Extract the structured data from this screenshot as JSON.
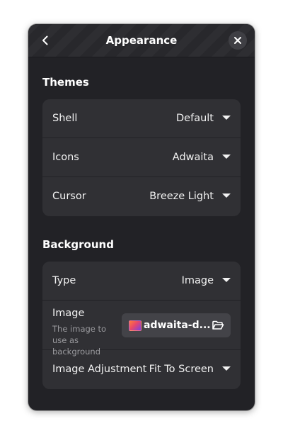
{
  "header": {
    "title": "Appearance"
  },
  "themes": {
    "section_title": "Themes",
    "rows": [
      {
        "label": "Shell",
        "value": "Default"
      },
      {
        "label": "Icons",
        "value": "Adwaita"
      },
      {
        "label": "Cursor",
        "value": "Breeze Light"
      }
    ]
  },
  "background": {
    "section_title": "Background",
    "type": {
      "label": "Type",
      "value": "Image"
    },
    "image": {
      "label": "Image",
      "subtitle": "The image to use as background",
      "file_name": "adwaita-d..."
    },
    "adjustment": {
      "label": "Image Adjustment",
      "value": "Fit To Screen"
    }
  },
  "colors": {
    "window_bg": "#222226",
    "card_bg": "#303034",
    "button_bg": "#434348"
  }
}
